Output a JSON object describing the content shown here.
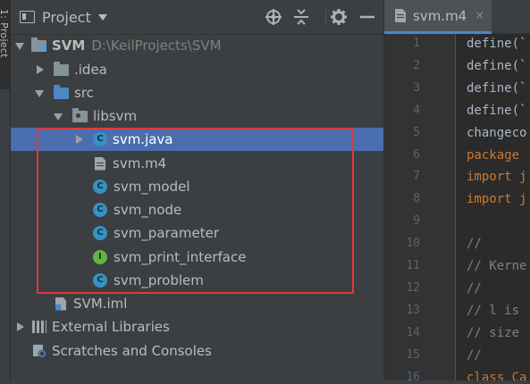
{
  "tool_strip": {
    "label": "1: Project"
  },
  "panel": {
    "title": "Project",
    "header_icons": [
      "target-icon",
      "collapse-icon",
      "gear-icon",
      "minimize-icon"
    ]
  },
  "tree": [
    {
      "label": "SVM",
      "path": "D:\\KeilProjects\\SVM",
      "icon": "module-folder",
      "expanded": true
    },
    {
      "label": ".idea",
      "icon": "folder",
      "expanded": false
    },
    {
      "label": "src",
      "icon": "source-folder",
      "expanded": true
    },
    {
      "label": "libsvm",
      "icon": "package-folder",
      "expanded": true
    },
    {
      "label": "svm.java",
      "icon": "class-c",
      "expanded": false,
      "selected": true
    },
    {
      "label": "svm.m4",
      "icon": "text-file"
    },
    {
      "label": "svm_model",
      "icon": "class-c"
    },
    {
      "label": "svm_node",
      "icon": "class-c"
    },
    {
      "label": "svm_parameter",
      "icon": "class-c"
    },
    {
      "label": "svm_print_interface",
      "icon": "interface-i"
    },
    {
      "label": "svm_problem",
      "icon": "class-c"
    },
    {
      "label": "SVM.iml",
      "icon": "iml-file"
    },
    {
      "label": "External Libraries",
      "icon": "libraries",
      "expanded": false
    },
    {
      "label": "Scratches and Consoles",
      "icon": "scratches"
    }
  ],
  "editor": {
    "tab": {
      "label": "svm.m4",
      "close": "×"
    },
    "line_numbers": [
      "1",
      "2",
      "3",
      "4",
      "5",
      "6",
      "7",
      "8",
      "9",
      "10",
      "11",
      "12",
      "13",
      "14",
      "15",
      "16"
    ],
    "lines": [
      "define(`",
      "define(`",
      "define(`",
      "define(`",
      "changeco",
      "package ",
      "import j",
      "import j",
      "",
      "//",
      "// Kerne",
      "//",
      "// l is ",
      "// size ",
      "//",
      "class Ca"
    ]
  },
  "colors": {
    "panel_bg": "#3c3f41",
    "editor_bg": "#2b2b2b",
    "selection": "#4b6eaf",
    "highlight_box": "#e0393e",
    "class_icon": "#3592c4",
    "interface_icon": "#62b543"
  }
}
